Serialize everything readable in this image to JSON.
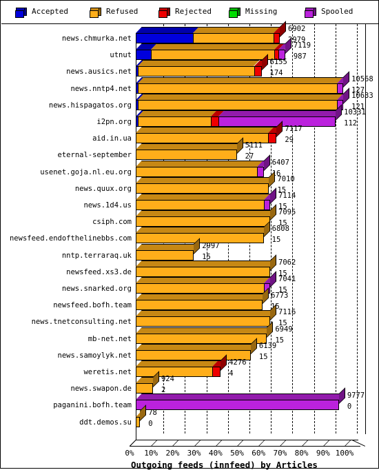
{
  "legend": {
    "items": [
      {
        "label": "Accepted",
        "color": "#0000dd",
        "icon": "cube-icon"
      },
      {
        "label": "Refused",
        "color": "#ffae1a",
        "icon": "cube-icon"
      },
      {
        "label": "Rejected",
        "color": "#ee0000",
        "icon": "cube-icon"
      },
      {
        "label": "Missing",
        "color": "#00dd00",
        "icon": "cube-icon"
      },
      {
        "label": "Spooled",
        "color": "#bb22dd",
        "icon": "cube-icon"
      }
    ]
  },
  "axis": {
    "x_title": "Outgoing feeds (innfeed) by Articles",
    "x_ticks": [
      "0%",
      "10%",
      "20%",
      "30%",
      "40%",
      "50%",
      "60%",
      "70%",
      "80%",
      "90%",
      "100%"
    ]
  },
  "chart_data": {
    "type": "bar",
    "orientation": "horizontal",
    "stacked": true,
    "title": "Outgoing feeds (innfeed) by Articles",
    "xlabel": "Outgoing feeds (innfeed) by Articles",
    "ylabel": "",
    "xlim": [
      0,
      100
    ],
    "xunit": "%",
    "grid": true,
    "legend_position": "top",
    "series_names": [
      "Accepted",
      "Refused",
      "Rejected",
      "Missing",
      "Spooled"
    ],
    "series_colors": [
      "#0000dd",
      "#ffae1a",
      "#ee0000",
      "#00dd00",
      "#bb22dd"
    ],
    "categories": [
      "news.chmurka.net",
      "utnut",
      "news.ausics.net",
      "news.nntp4.net",
      "news.hispagatos.org",
      "i2pn.org",
      "aid.in.ua",
      "eternal-september",
      "usenet.goja.nl.eu.org",
      "news.quux.org",
      "news.1d4.us",
      "csiph.com",
      "newsfeed.endofthelinebbs.com",
      "nntp.terraraq.uk",
      "newsfeed.xs3.de",
      "news.snarked.org",
      "newsfeed.bofh.team",
      "news.tnetconsulting.net",
      "mb-net.net",
      "news.samoylyk.net",
      "weretis.net",
      "news.swapon.de",
      "paganini.bofh.team",
      "ddt.demos.su"
    ],
    "rows": [
      {
        "label": "news.chmurka.net",
        "total": 6902,
        "second": 2979,
        "segments": [
          {
            "name": "Accepted",
            "pct": 26.5
          },
          {
            "name": "Refused",
            "pct": 37.5
          },
          {
            "name": "Rejected",
            "pct": 3.0
          }
        ]
      },
      {
        "label": "utnut",
        "total": 7119,
        "second": 987,
        "segments": [
          {
            "name": "Accepted",
            "pct": 7.0
          },
          {
            "name": "Refused",
            "pct": 57.5
          },
          {
            "name": "Rejected",
            "pct": 2.0
          },
          {
            "name": "Spooled",
            "pct": 3.0
          }
        ]
      },
      {
        "label": "news.ausics.net",
        "total": 6155,
        "second": 174,
        "segments": [
          {
            "name": "Accepted",
            "pct": 1.0
          },
          {
            "name": "Refused",
            "pct": 54.0
          },
          {
            "name": "Rejected",
            "pct": 3.5
          }
        ]
      },
      {
        "label": "news.nntp4.net",
        "total": 10568,
        "second": 127,
        "segments": [
          {
            "name": "Accepted",
            "pct": 1.0
          },
          {
            "name": "Refused",
            "pct": 92.5
          },
          {
            "name": "Spooled",
            "pct": 3.0
          }
        ]
      },
      {
        "label": "news.hispagatos.org",
        "total": 10633,
        "second": 121,
        "segments": [
          {
            "name": "Accepted",
            "pct": 1.0
          },
          {
            "name": "Refused",
            "pct": 92.5
          },
          {
            "name": "Spooled",
            "pct": 3.0
          }
        ]
      },
      {
        "label": "i2pn.org",
        "total": 10331,
        "second": 112,
        "segments": [
          {
            "name": "Accepted",
            "pct": 1.0
          },
          {
            "name": "Refused",
            "pct": 34.0
          },
          {
            "name": "Rejected",
            "pct": 3.5
          },
          {
            "name": "Spooled",
            "pct": 54.5
          }
        ]
      },
      {
        "label": "aid.in.ua",
        "total": 7117,
        "second": 29,
        "segments": [
          {
            "name": "Refused",
            "pct": 61.5
          },
          {
            "name": "Rejected",
            "pct": 4.0
          }
        ]
      },
      {
        "label": "eternal-september",
        "total": 5111,
        "second": 27,
        "segments": [
          {
            "name": "Refused",
            "pct": 47.0
          }
        ]
      },
      {
        "label": "usenet.goja.nl.eu.org",
        "total": 6407,
        "second": 16,
        "segments": [
          {
            "name": "Refused",
            "pct": 56.5
          },
          {
            "name": "Spooled",
            "pct": 3.0
          }
        ]
      },
      {
        "label": "news.quux.org",
        "total": 7010,
        "second": 15,
        "segments": [
          {
            "name": "Refused",
            "pct": 62.0
          }
        ]
      },
      {
        "label": "news.1d4.us",
        "total": 7114,
        "second": 15,
        "segments": [
          {
            "name": "Refused",
            "pct": 59.5
          },
          {
            "name": "Spooled",
            "pct": 3.0
          }
        ]
      },
      {
        "label": "csiph.com",
        "total": 7095,
        "second": 15,
        "segments": [
          {
            "name": "Refused",
            "pct": 62.5
          }
        ]
      },
      {
        "label": "newsfeed.endofthelinebbs.com",
        "total": 6808,
        "second": 15,
        "segments": [
          {
            "name": "Refused",
            "pct": 59.5
          }
        ]
      },
      {
        "label": "nntp.terraraq.uk",
        "total": 2997,
        "second": 15,
        "segments": [
          {
            "name": "Refused",
            "pct": 27.0
          }
        ]
      },
      {
        "label": "newsfeed.xs3.de",
        "total": 7062,
        "second": 15,
        "segments": [
          {
            "name": "Refused",
            "pct": 62.5
          }
        ]
      },
      {
        "label": "news.snarked.org",
        "total": 7041,
        "second": 15,
        "segments": [
          {
            "name": "Refused",
            "pct": 59.5
          },
          {
            "name": "Spooled",
            "pct": 3.0
          }
        ]
      },
      {
        "label": "newsfeed.bofh.team",
        "total": 6773,
        "second": 15,
        "segments": [
          {
            "name": "Refused",
            "pct": 59.0
          }
        ]
      },
      {
        "label": "news.tnetconsulting.net",
        "total": 7116,
        "second": 15,
        "segments": [
          {
            "name": "Refused",
            "pct": 62.5
          }
        ]
      },
      {
        "label": "mb-net.net",
        "total": 6949,
        "second": 15,
        "segments": [
          {
            "name": "Refused",
            "pct": 61.0
          }
        ]
      },
      {
        "label": "news.samoylyk.net",
        "total": 6139,
        "second": 15,
        "segments": [
          {
            "name": "Refused",
            "pct": 53.5
          }
        ]
      },
      {
        "label": "weretis.net",
        "total": 4276,
        "second": 4,
        "segments": [
          {
            "name": "Refused",
            "pct": 35.5
          },
          {
            "name": "Rejected",
            "pct": 4.0
          }
        ]
      },
      {
        "label": "news.swapon.de",
        "total": 924,
        "second": 2,
        "segments": [
          {
            "name": "Refused",
            "pct": 8.0
          }
        ]
      },
      {
        "label": "paganini.bofh.team",
        "total": 9777,
        "second": 0,
        "segments": [
          {
            "name": "Spooled",
            "pct": 94.5
          }
        ]
      },
      {
        "label": "ddt.demos.su",
        "total": 78,
        "second": 0,
        "segments": [
          {
            "name": "Refused",
            "pct": 2.0
          }
        ]
      }
    ]
  }
}
